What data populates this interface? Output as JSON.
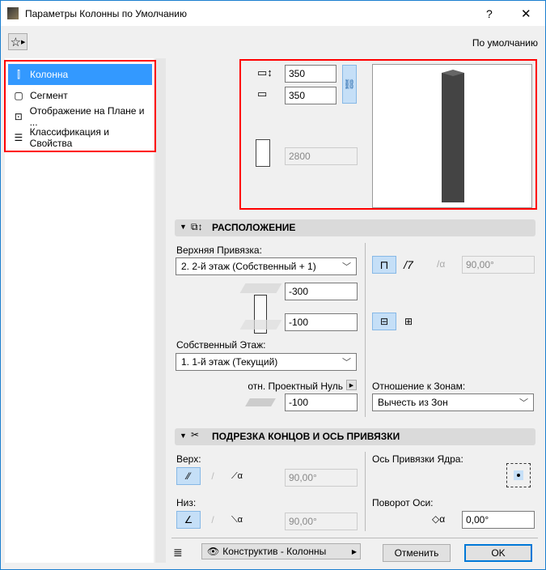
{
  "window": {
    "title": "Параметры Колонны по Умолчанию",
    "help": "?",
    "close": "✕"
  },
  "header": {
    "preset": "По умолчанию"
  },
  "sidebar": {
    "items": [
      {
        "label": "Колонна",
        "icon": "column-icon",
        "selected": true
      },
      {
        "label": "Сегмент",
        "icon": "segment-icon"
      },
      {
        "label": "Отображение на Плане и ...",
        "icon": "floor-plan-icon"
      },
      {
        "label": "Классификация и Свойства",
        "icon": "document-icon"
      }
    ]
  },
  "geometry": {
    "width": "350",
    "depth": "350",
    "height": "2800"
  },
  "placement": {
    "title": "РАСПОЛОЖЕНИЕ",
    "top_link_label": "Верхняя Привязка:",
    "top_link_value": "2. 2-й этаж (Собственный + 1)",
    "top_offset": "-300",
    "bottom_offset": "-100",
    "home_story_label": "Собственный Этаж:",
    "home_story_value": "1. 1-й этаж (Текущий)",
    "project_zero_label": "отн. Проектный Нуль",
    "project_zero_value": "-100",
    "slant_angle": "90,00°",
    "zones_label": "Отношение к Зонам:",
    "zones_value": "Вычесть из Зон"
  },
  "trim": {
    "title": "ПОДРЕЗКА КОНЦОВ И ОСЬ ПРИВЯЗКИ",
    "top_label": "Верх:",
    "top_angle": "90,00°",
    "bottom_label": "Низ:",
    "bottom_angle": "90,00°",
    "anchor_label": "Ось Привязки Ядра:",
    "rotation_label": "Поворот Оси:",
    "rotation_value": "0,00°"
  },
  "footer": {
    "layer": "Конструктив - Колонны",
    "cancel": "Отменить",
    "ok": "OK"
  }
}
